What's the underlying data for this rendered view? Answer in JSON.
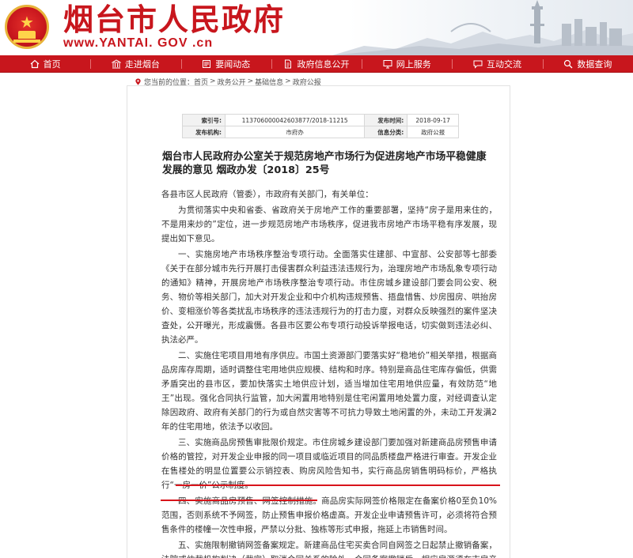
{
  "header": {
    "site_title": "烟台市人民政府",
    "site_url": "www.YANTAI. GOV .cn"
  },
  "nav": {
    "items": [
      {
        "label": "首页"
      },
      {
        "label": "走进烟台"
      },
      {
        "label": "要闻动态"
      },
      {
        "label": "政府信息公开"
      },
      {
        "label": "网上服务"
      },
      {
        "label": "互动交流"
      },
      {
        "label": "数据查询"
      }
    ]
  },
  "breadcrumb": {
    "prefix": "您当前的位置：",
    "items": [
      "首页",
      "政务公开",
      "基础信息",
      "政府公报"
    ],
    "separator": ">"
  },
  "meta": {
    "index_label": "索引号:",
    "index_value": "11370600004260387​7/2018-11215",
    "date_label": "发布时间:",
    "date_value": "2018-09-17",
    "org_label": "发布机构:",
    "org_value": "市府办",
    "cat_label": "信息分类:",
    "cat_value": "政府公报"
  },
  "article": {
    "title": "烟台市人民政府办公室关于规范房地产市场行为促进房地产市场平稳健康发展的意见 烟政办发〔2018〕25号",
    "salutation": "各县市区人民政府（管委），市政府有关部门，有关单位：",
    "paragraphs": [
      "为贯彻落实中央和省委、省政府关于房地产工作的重要部署，坚持“房子是用来住的，不是用来炒的”定位，进一步规范房地产市场秩序，促进我市房地产市场平稳有序发展，现提出如下意见。",
      "一、实施房地产市场秩序整治专项行动。全面落实住建部、中宣部、公安部等七部委《关于在部分城市先行开展打击侵害群众利益违法违规行为，治理房地产市场乱象专项行动的通知》精神，开展房地产市场秩序整治专项行动。市住房城乡建设部门要会同公安、税务、物价等相关部门，加大对开发企业和中介机构违规预售、捂盘惜售、炒房囤房、哄抬房价、变相涨价等各类扰乱市场秩序的违法违规行为的打击力度，对群众反映强烈的案件坚决查处，公开曝光，形成震慑。各县市区要公布专项行动投诉举报电话，切实做到违法必纠、执法必严。",
      "二、实施住宅项目用地有序供应。市国土资源部门要落实好“稳地价”相关举措，根据商品房库存周期，适时调整住宅用地供应规模、结构和时序。特别是商品住宅库存偏低，供需矛盾突出的县市区，要加快落实土地供应计划，适当增加住宅用地供应量，有效防范“地王”出现。强化合同执行监管，加大闲置用地特别是住宅闲置用地处置力度，对经调查认定除因政府、政府有关部门的行为或自然灾害等不可抗力导致土地闲置的外，未动工开发满2年的住宅用地，依法予以收回。",
      "三、实施商品房预售审批限价规定。市住房城乡建设部门要加强对新建商品房预售申请价格的管控，对开发企业申报的同一项目或临近项目的同品质楼盘严格进行审查。开发企业在售楼处的明显位置要公示销控表、购房风险告知书，实行商品房销售明码标价，严格执行“一房一价”公示制度。",
      "四、实施商品房预售、网签控制措施。商品房实际网签价格限定在备案价格0至负10%范围，否则系统不予网签，防止预售申报价格虚高。开发企业申请预售许可，必须将符合预售条件的楼幢一次性申报，严禁以分批、独栋等形式申报，拖延上市销售时间。",
      "五、实施限制撤销网签备案规定。新建商品住宅买卖合同自网签之日起禁止撤销备案，法院或仲裁机构判决（裁定）取消合同关系的除外。合同备案撤销后，相应房源须在市房产交易网公示一周后方可另行签定网签合同。"
    ]
  },
  "colors": {
    "brand_red": "#c8161d",
    "annotation_red": "#d8141b"
  },
  "icons": {
    "nav": [
      "home-icon",
      "landmark-icon",
      "news-icon",
      "document-icon",
      "monitor-icon",
      "chat-icon",
      "search-data-icon"
    ],
    "breadcrumb": "location-pin-icon"
  }
}
